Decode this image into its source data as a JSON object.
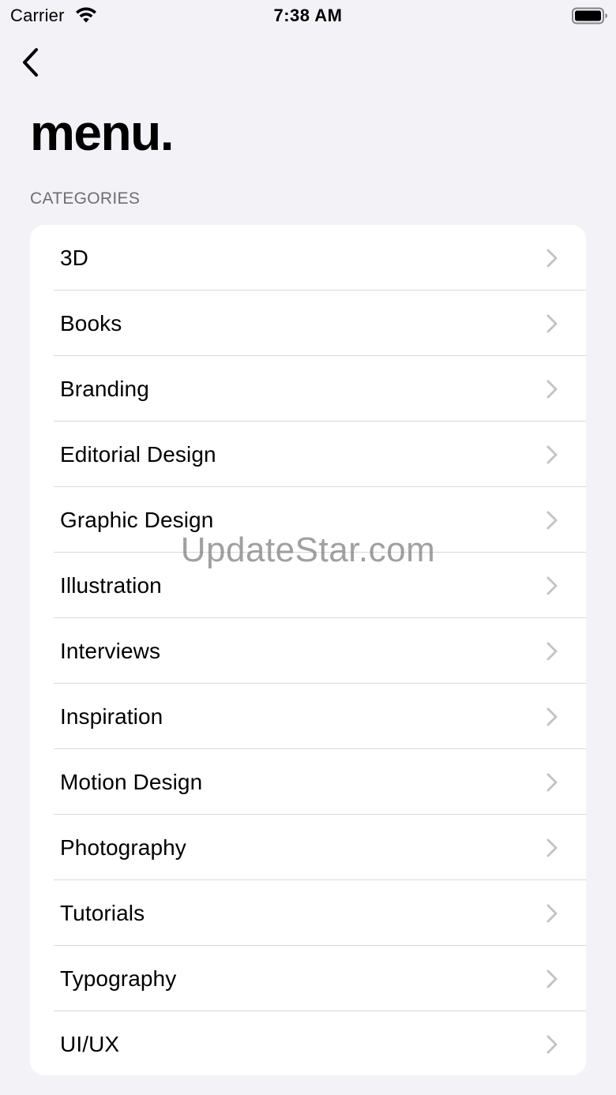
{
  "status_bar": {
    "carrier": "Carrier",
    "time": "7:38 AM",
    "icons": [
      "wifi-icon",
      "battery-icon"
    ]
  },
  "nav": {
    "back_icon": "chevron-left-icon"
  },
  "page": {
    "title": "menu."
  },
  "section": {
    "header": "CATEGORIES"
  },
  "categories": [
    {
      "label": "3D"
    },
    {
      "label": "Books"
    },
    {
      "label": "Branding"
    },
    {
      "label": "Editorial Design"
    },
    {
      "label": "Graphic Design"
    },
    {
      "label": "Illustration"
    },
    {
      "label": "Interviews"
    },
    {
      "label": "Inspiration"
    },
    {
      "label": "Motion Design"
    },
    {
      "label": "Photography"
    },
    {
      "label": "Tutorials"
    },
    {
      "label": "Typography"
    },
    {
      "label": "UI/UX"
    }
  ],
  "row_icon": "chevron-right-icon",
  "watermark": "UpdateStar.com",
  "colors": {
    "background": "#f2f2f7",
    "card": "#ffffff",
    "section_header": "#6d6d72",
    "separator": "#d8d8dc",
    "chevron": "#c4c4c7"
  }
}
